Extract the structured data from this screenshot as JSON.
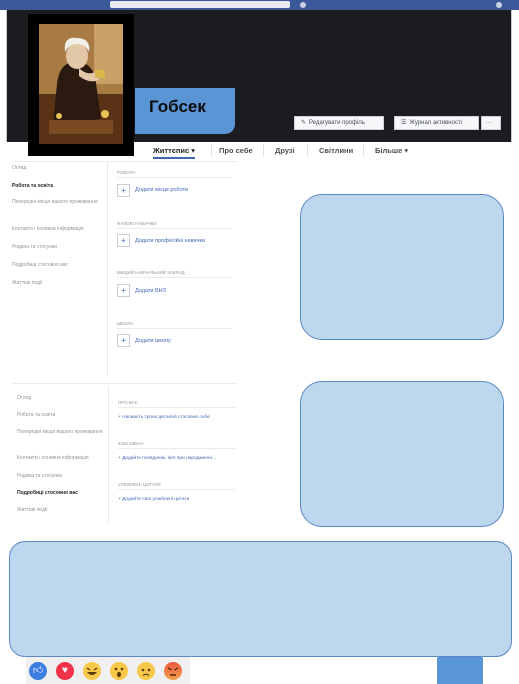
{
  "profile": {
    "name": "Гобсек"
  },
  "cover_buttons": {
    "edit_profile": "Редагувати профіль",
    "activity_log": "Журнал активності",
    "more": "···"
  },
  "tabs": [
    {
      "label": "Життєпис ▾",
      "active": true
    },
    {
      "label": "Про себе",
      "active": false
    },
    {
      "label": "Друзі",
      "active": false
    },
    {
      "label": "Світлини",
      "active": false
    },
    {
      "label": "Більше ▾",
      "active": false
    }
  ],
  "about_sidebar_top": [
    {
      "label": "Огляд",
      "active": false
    },
    {
      "label": "Робота та освіта",
      "active": true
    },
    {
      "label": "Попередні місця вашого проживання",
      "active": false
    },
    {
      "label": "Контакти і основна інформація",
      "active": false
    },
    {
      "label": "Родина та стосунки",
      "active": false
    },
    {
      "label": "Подробиці стосовно вас",
      "active": false
    },
    {
      "label": "Життєві події",
      "active": false
    }
  ],
  "about_sections_top": [
    {
      "heading": "РОБОТА",
      "add_label": "Додати місце роботи"
    },
    {
      "heading": "ФАХОВІ НАВИЧКИ",
      "add_label": "Додати професійні навички"
    },
    {
      "heading": "ВИЩИЙ НАВЧАЛЬНИЙ ЗАКЛАД",
      "add_label": "Додати ВНЗ"
    },
    {
      "heading": "ШКОЛА",
      "add_label": "Додати школу"
    }
  ],
  "about_sidebar_bottom": [
    {
      "label": "Огляд",
      "active": false
    },
    {
      "label": "Робота та освіта",
      "active": false
    },
    {
      "label": "Попередні місця вашого проживання",
      "active": false
    },
    {
      "label": "Контакти і основна інформація",
      "active": false
    },
    {
      "label": "Родина та стосунки",
      "active": false
    },
    {
      "label": "Подробиці стосовно вас",
      "active": true
    },
    {
      "label": "Життєві події",
      "active": false
    }
  ],
  "about_sections_bottom": [
    {
      "heading": "ПРО ВАС",
      "add_label": "+ Напишіть трохи деталей стосовно себе"
    },
    {
      "heading": "ІНШІ ІМЕНА",
      "add_label": "+ Додайте псевдонім, ім'я при народженні…"
    },
    {
      "heading": "УЛЮБЛЕНІ ЦИТАТИ",
      "add_label": "+ Додайте свої улюблені цитати"
    }
  ],
  "reactions": [
    "like",
    "love",
    "haha",
    "wow",
    "sad",
    "angry"
  ],
  "colors": {
    "facebook_blue": "#3b5998",
    "link_blue": "#4267b2",
    "name_plate": "#5a95d5",
    "placeholder_fill": "#bdd7ee",
    "placeholder_border": "#5b87c2",
    "cover_dark": "#1b1c20"
  }
}
